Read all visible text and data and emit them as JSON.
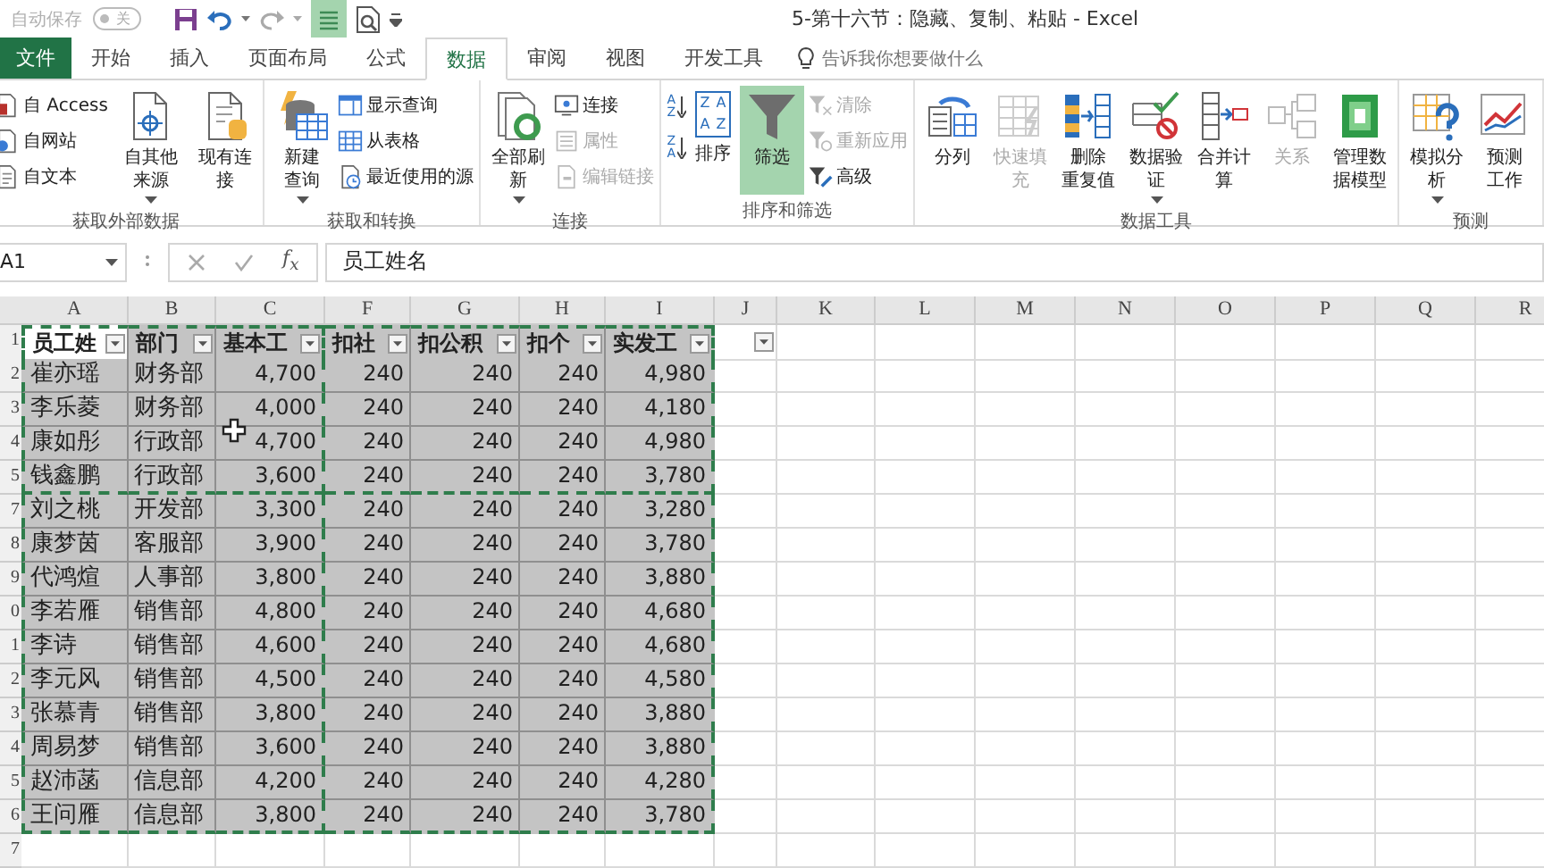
{
  "title_bar": {
    "autosave_label": "自动保存",
    "autosave": {
      "on": false,
      "state_label": "关"
    },
    "title": "5-第十六节：隐藏、复制、粘贴 - Excel"
  },
  "tabs": [
    {
      "label": "文件",
      "kind": "file",
      "selected": false
    },
    {
      "label": "开始",
      "kind": "tab",
      "selected": false
    },
    {
      "label": "插入",
      "kind": "tab",
      "selected": false
    },
    {
      "label": "页面布局",
      "kind": "tab",
      "selected": false
    },
    {
      "label": "公式",
      "kind": "tab",
      "selected": false
    },
    {
      "label": "数据",
      "kind": "tab",
      "selected": true
    },
    {
      "label": "审阅",
      "kind": "tab",
      "selected": false
    },
    {
      "label": "视图",
      "kind": "tab",
      "selected": false
    },
    {
      "label": "开发工具",
      "kind": "tab",
      "selected": false
    }
  ],
  "tell_me": {
    "placeholder": "告诉我你想要做什么"
  },
  "ribbon_groups": [
    {
      "label": "获取外部数据",
      "items": [
        {
          "kind": "stack",
          "items": [
            {
              "kind": "button",
              "label": "自 Access",
              "disabled": false
            },
            {
              "kind": "button",
              "label": "自网站",
              "disabled": false
            },
            {
              "kind": "button",
              "label": "自文本",
              "disabled": false
            }
          ]
        },
        {
          "kind": "large",
          "label": "自其他来源",
          "dropdown": true,
          "disabled": false,
          "selected": false
        },
        {
          "kind": "large",
          "label": "现有连接",
          "dropdown": false,
          "disabled": false,
          "selected": false
        }
      ]
    },
    {
      "label": "获取和转换",
      "items": [
        {
          "kind": "large",
          "lines": [
            "新建",
            "查询"
          ],
          "dropdown": true,
          "disabled": false,
          "selected": false
        },
        {
          "kind": "stack",
          "items": [
            {
              "kind": "button",
              "label": "显示查询",
              "disabled": false
            },
            {
              "kind": "button",
              "label": "从表格",
              "disabled": false
            },
            {
              "kind": "button",
              "label": "最近使用的源",
              "disabled": false
            }
          ]
        }
      ]
    },
    {
      "label": "连接",
      "items": [
        {
          "kind": "large",
          "label": "全部刷新",
          "dropdown": true,
          "disabled": false,
          "selected": false
        },
        {
          "kind": "stack",
          "items": [
            {
              "kind": "button",
              "label": "连接",
              "disabled": false
            },
            {
              "kind": "button",
              "label": "属性",
              "disabled": true
            },
            {
              "kind": "button",
              "label": "编辑链接",
              "disabled": true
            }
          ]
        }
      ]
    },
    {
      "label": "排序和筛选",
      "items": [
        {
          "kind": "stack",
          "items": [
            {
              "kind": "sort",
              "letters": [
                "A",
                "Z"
              ]
            },
            {
              "kind": "sort",
              "letters": [
                "Z",
                "A"
              ]
            }
          ]
        },
        {
          "kind": "large",
          "label": "排序",
          "letters": [
            "Z",
            "A",
            "A",
            "Z"
          ],
          "dropdown": false,
          "disabled": false,
          "selected": false
        },
        {
          "kind": "large",
          "label": "筛选",
          "dropdown": false,
          "disabled": false,
          "selected": true
        },
        {
          "kind": "stack",
          "items": [
            {
              "kind": "button",
              "label": "清除",
              "disabled": true
            },
            {
              "kind": "button",
              "label": "重新应用",
              "disabled": true
            },
            {
              "kind": "button",
              "label": "高级",
              "disabled": false
            }
          ]
        }
      ]
    },
    {
      "label": "数据工具",
      "items": [
        {
          "kind": "large",
          "label": "分列",
          "dropdown": false,
          "disabled": false,
          "selected": false
        },
        {
          "kind": "large",
          "label": "快速填充",
          "dropdown": false,
          "disabled": true,
          "selected": false
        },
        {
          "kind": "large",
          "lines": [
            "删除",
            "重复值"
          ],
          "dropdown": false,
          "disabled": false,
          "selected": false
        },
        {
          "kind": "large",
          "lines": [
            "数据验",
            "证"
          ],
          "dropdown": true,
          "disabled": false,
          "selected": false
        },
        {
          "kind": "large",
          "label": "合并计算",
          "dropdown": false,
          "disabled": false,
          "selected": false
        },
        {
          "kind": "large",
          "label": "关系",
          "dropdown": false,
          "disabled": true,
          "selected": false
        },
        {
          "kind": "large",
          "lines": [
            "管理数",
            "据模型"
          ],
          "dropdown": false,
          "disabled": false,
          "selected": false
        }
      ]
    },
    {
      "label": "预测",
      "items": [
        {
          "kind": "large",
          "label": "模拟分析",
          "dropdown": true,
          "disabled": false,
          "selected": false
        },
        {
          "kind": "large",
          "lines": [
            "预测",
            "工作"
          ],
          "dropdown": false,
          "disabled": false,
          "selected": false
        }
      ]
    }
  ],
  "formula_bar": {
    "name_box": "A1",
    "function_label": "f$_{x}$",
    "formula": "员工姓名"
  },
  "sheet": {
    "columns": [
      "A",
      "B",
      "C",
      "F",
      "G",
      "H",
      "I",
      "J",
      "K",
      "L",
      "M",
      "N",
      "O",
      "P",
      "Q",
      "R"
    ],
    "copy_marquee": true,
    "rows": [
      {
        "number": "1",
        "kind": "header",
        "selected": true,
        "cells": [
          {
            "text": "员工姓",
            "filter": true,
            "active": true
          },
          {
            "text": "部门",
            "filter": true,
            "active": false
          },
          {
            "text": "基本工",
            "filter": true,
            "active": false
          },
          {
            "text": "扣社",
            "filter": true,
            "active": false
          },
          {
            "text": "扣公积",
            "filter": true,
            "active": false
          },
          {
            "text": "扣个",
            "filter": true,
            "active": false
          },
          {
            "text": "实发工",
            "filter": true,
            "active": false
          },
          {
            "filter": true,
            "active": false
          }
        ]
      },
      {
        "number": "2",
        "kind": "data",
        "selected": true,
        "cells": [
          "崔亦瑶",
          "财务部",
          "4,700",
          "240",
          "240",
          "240",
          "4,980"
        ]
      },
      {
        "number": "3",
        "kind": "data",
        "selected": true,
        "cells": [
          "李乐菱",
          "财务部",
          "4,000",
          "240",
          "240",
          "240",
          "4,180"
        ]
      },
      {
        "number": "4",
        "kind": "data",
        "selected": true,
        "cells": [
          "康如彤",
          "行政部",
          "4,700",
          "240",
          "240",
          "240",
          "4,980"
        ]
      },
      {
        "number": "5",
        "kind": "data",
        "selected": true,
        "cells": [
          "钱鑫鹏",
          "行政部",
          "3,600",
          "240",
          "240",
          "240",
          "3,780"
        ]
      },
      {
        "number": "7",
        "kind": "data",
        "selected": true,
        "cells": [
          "刘之桃",
          "开发部",
          "3,300",
          "240",
          "240",
          "240",
          "3,280"
        ]
      },
      {
        "number": "8",
        "kind": "data",
        "selected": true,
        "cells": [
          "康梦茵",
          "客服部",
          "3,900",
          "240",
          "240",
          "240",
          "3,780"
        ]
      },
      {
        "number": "9",
        "kind": "data",
        "selected": true,
        "cells": [
          "代鸿煊",
          "人事部",
          "3,800",
          "240",
          "240",
          "240",
          "3,880"
        ]
      },
      {
        "number": "0",
        "kind": "data",
        "selected": true,
        "cells": [
          "李若雁",
          "销售部",
          "4,800",
          "240",
          "240",
          "240",
          "4,680"
        ]
      },
      {
        "number": "1",
        "kind": "data",
        "selected": true,
        "cells": [
          "李诗",
          "销售部",
          "4,600",
          "240",
          "240",
          "240",
          "4,680"
        ]
      },
      {
        "number": "2",
        "kind": "data",
        "selected": true,
        "cells": [
          "李元风",
          "销售部",
          "4,500",
          "240",
          "240",
          "240",
          "4,580"
        ]
      },
      {
        "number": "3",
        "kind": "data",
        "selected": true,
        "cells": [
          "张慕青",
          "销售部",
          "3,800",
          "240",
          "240",
          "240",
          "3,880"
        ]
      },
      {
        "number": "4",
        "kind": "data",
        "selected": true,
        "cells": [
          "周易梦",
          "销售部",
          "3,600",
          "240",
          "240",
          "240",
          "3,880"
        ]
      },
      {
        "number": "5",
        "kind": "data",
        "selected": true,
        "cells": [
          "赵沛菡",
          "信息部",
          "4,200",
          "240",
          "240",
          "240",
          "4,280"
        ]
      },
      {
        "number": "6",
        "kind": "data",
        "selected": true,
        "cells": [
          "王问雁",
          "信息部",
          "3,800",
          "240",
          "240",
          "240",
          "3,780"
        ]
      },
      {
        "number": "7",
        "kind": "data",
        "selected": false
      }
    ]
  }
}
